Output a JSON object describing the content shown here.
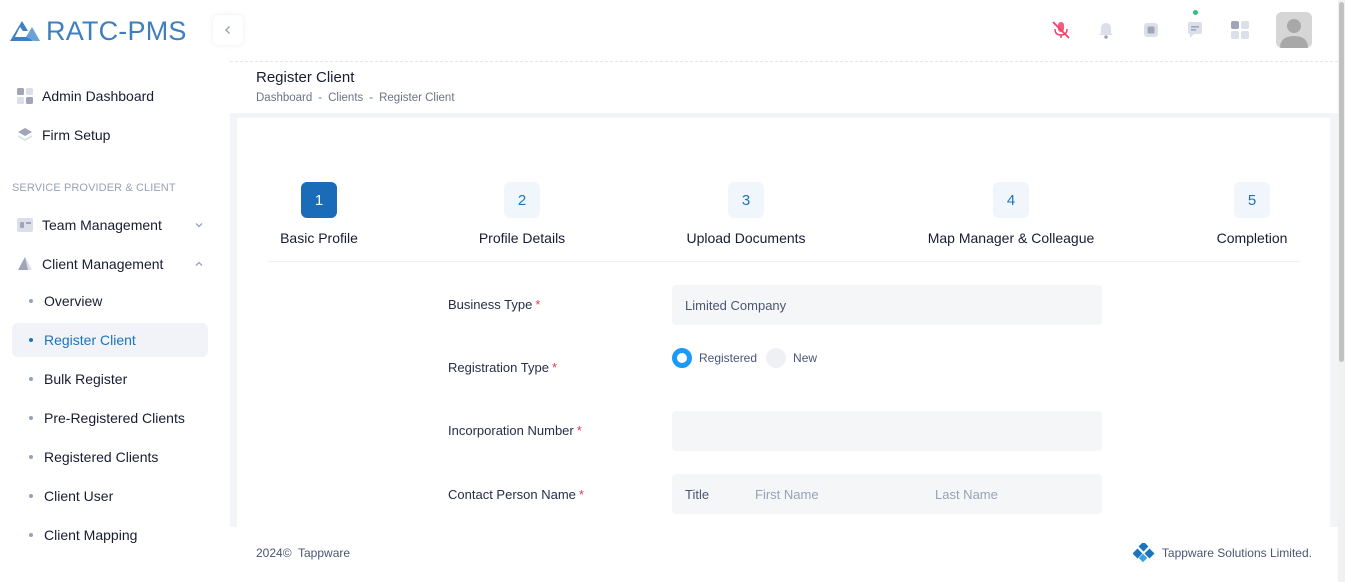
{
  "app": {
    "name": "RATC-PMS",
    "brand_color": "#3f7fc0"
  },
  "sidebar": {
    "items": [
      {
        "label": "Admin Dashboard",
        "icon": "dashboard-grid-icon"
      },
      {
        "label": "Firm Setup",
        "icon": "layers-icon"
      }
    ],
    "section_title": "SERVICE PROVIDER & CLIENT",
    "groups": [
      {
        "label": "Team Management",
        "icon": "team-card-icon",
        "expanded": false
      },
      {
        "label": "Client Management",
        "icon": "client-triangle-icon",
        "expanded": true
      }
    ],
    "sub_items": [
      {
        "label": "Overview"
      },
      {
        "label": "Register Client",
        "active": true
      },
      {
        "label": "Bulk Register"
      },
      {
        "label": "Pre-Registered Clients"
      },
      {
        "label": "Registered Clients"
      },
      {
        "label": "Client User"
      },
      {
        "label": "Client Mapping"
      }
    ]
  },
  "header": {
    "icons": [
      "microphone-muted-icon",
      "bell-icon",
      "chip-icon",
      "chat-icon",
      "apps-grid-icon",
      "user-avatar"
    ]
  },
  "page": {
    "title": "Register Client",
    "breadcrumb": [
      "Dashboard",
      "Clients",
      "Register Client"
    ]
  },
  "stepper": {
    "steps": [
      {
        "number": "1",
        "label": "Basic Profile",
        "active": true
      },
      {
        "number": "2",
        "label": "Profile Details"
      },
      {
        "number": "3",
        "label": "Upload Documents"
      },
      {
        "number": "4",
        "label": "Map Manager & Colleague"
      },
      {
        "number": "5",
        "label": "Completion"
      }
    ]
  },
  "form": {
    "business_type": {
      "label": "Business Type",
      "value": "Limited Company"
    },
    "registration_type": {
      "label": "Registration Type",
      "options": [
        "Registered",
        "New"
      ],
      "selected": "Registered"
    },
    "incorporation_number": {
      "label": "Incorporation Number",
      "value": ""
    },
    "contact_person": {
      "label": "Contact Person Name",
      "title": "Title",
      "first_name_placeholder": "First Name",
      "last_name_placeholder": "Last Name"
    },
    "required_marker": "*"
  },
  "footer": {
    "year": "2024©",
    "company": "Tappware",
    "right_text": "Tappware Solutions Limited."
  }
}
